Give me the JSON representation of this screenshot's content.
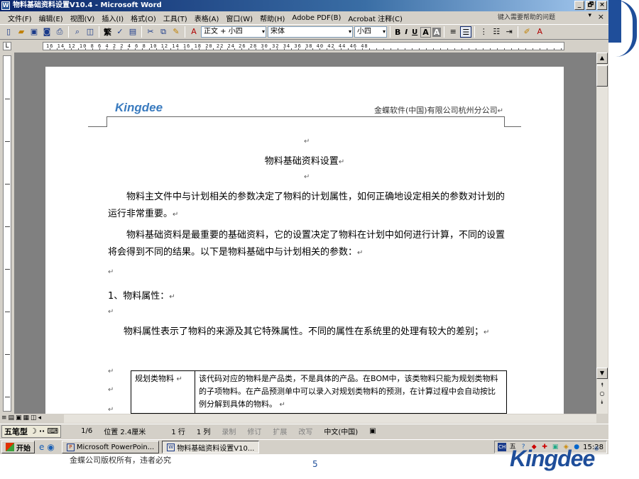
{
  "window": {
    "title": "物料基础资料设置V10.4 - Microsoft Word",
    "controls": [
      "_",
      "🗗",
      "×"
    ]
  },
  "menubar": {
    "items": [
      "文件(F)",
      "编辑(E)",
      "视图(V)",
      "插入(I)",
      "格式(O)",
      "工具(T)",
      "表格(A)",
      "窗口(W)",
      "帮助(H)",
      "Adobe PDF(B)",
      "Acrobat 注释(C)"
    ],
    "help_placeholder": "键入需要帮助的问题"
  },
  "toolbar": {
    "traditional_label": "繁",
    "style_label": "正文 + 小四",
    "font_name": "宋体",
    "font_size": "小四",
    "bold": "B",
    "italic": "I",
    "underline": "U",
    "highlight": "A",
    "font_color": "A"
  },
  "ruler": {
    "numbers": "16 14 12 10 8 6 4 2 2 4 6 8 10 12 14 16 18 20 22 24 26 28 30 32 34 36 38 40 42 44 46 48"
  },
  "document": {
    "header_logo": "Kingdee",
    "header_company": "金蝶软件(中国)有限公司杭州分公司",
    "title": "物料基础资料设置",
    "para_mark": "↵",
    "para1": "物料主文件中与计划相关的参数决定了物料的计划属性，如何正确地设定相关的参数对计划的运行非常重要。",
    "para2": "物料基础资料是最重要的基础资料，它的设置决定了物料在计划中如何进行计算，不同的设置将会得到不同的结果。以下是物料基础中与计划相关的参数：",
    "section1": "1、物料属性：",
    "para3": "物料属性表示了物料的来源及其它特殊属性。不同的属性在系统里的处理有较大的差别；",
    "table": [
      {
        "name": "规划类物料",
        "desc": "该代码对应的物料是产品类，不是具体的产品。在BOM中，该类物料只能为规划类物料的子项物料。在产品预测单中可以录入对规划类物料的预测，在计算过程中会自动按比例分解到具体的物料。"
      }
    ]
  },
  "statusbar": {
    "ime": "五笔型",
    "page": "1/6",
    "position": "位置 2.4厘米",
    "line": "1 行",
    "column": "1 列",
    "rec": "录制",
    "trk": "修订",
    "ext": "扩展",
    "ovr": "改写",
    "language": "中文(中国)"
  },
  "taskbar": {
    "start": "开始",
    "tasks": [
      "Microsoft PowerPoin...",
      "物料基础资料设置V10..."
    ],
    "clock": "15:28",
    "tray_labels": [
      "CH",
      "五"
    ]
  },
  "slide": {
    "copyright": "金蝶公司版权所有，违者必究",
    "page_number": "5",
    "logo": "Kingdee"
  },
  "colors": {
    "brand": "#1f4e9a",
    "titlebar": "#0a246a",
    "kingdee_header": "#3a7bbf"
  }
}
